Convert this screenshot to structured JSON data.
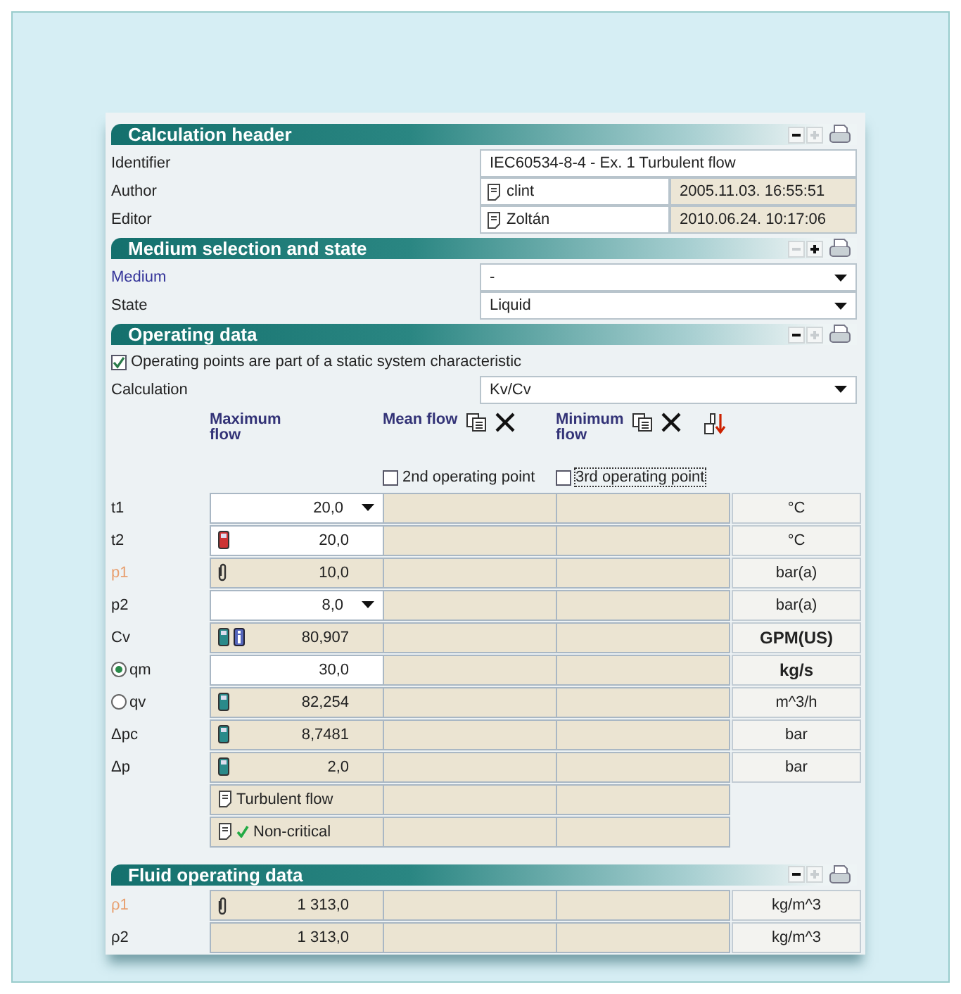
{
  "sections": [
    {
      "title": "Calculation header",
      "minus_enabled": true,
      "plus_enabled": false
    },
    {
      "title": "Medium selection and state",
      "minus_enabled": false,
      "plus_enabled": true
    },
    {
      "title": "Operating data",
      "minus_enabled": true,
      "plus_enabled": false
    },
    {
      "title": "Fluid operating data",
      "minus_enabled": true,
      "plus_enabled": false
    }
  ],
  "calculation_header": {
    "identifier": {
      "label": "Identifier",
      "value": "IEC60534-8-4 - Ex. 1 Turbulent flow"
    },
    "author": {
      "label": "Author",
      "value": "clint",
      "date": "2005.11.03. 16:55:51"
    },
    "editor": {
      "label": "Editor",
      "value": "Zoltán",
      "date": "2010.06.24. 10:17:06"
    }
  },
  "medium_selection": [
    {
      "label": "Medium",
      "value": "-",
      "color": "#333399"
    },
    {
      "label": "State",
      "value": "Liquid",
      "color": "#222222"
    }
  ],
  "operating_data": {
    "static_characteristic": {
      "label": "Operating points are part of a static system characteristic",
      "checked": true
    },
    "calculation": {
      "label": "Calculation",
      "value": "Kv/Cv"
    },
    "columns": [
      "Maximum flow",
      "Mean flow",
      "Minimum flow"
    ],
    "point_toggles": [
      {
        "label": "2nd operating point",
        "checked": false,
        "focused": false
      },
      {
        "label": "3rd operating point",
        "checked": false,
        "focused": true
      }
    ],
    "rows": [
      {
        "kind": "quantity",
        "label": "t1",
        "color": "#222222",
        "value": "20,0",
        "editable": true,
        "dropdown": true,
        "unit": "°C",
        "unit_bold": false
      },
      {
        "kind": "quantity",
        "label": "t2",
        "color": "#222222",
        "value": "20,0",
        "editable": true,
        "dropdown": false,
        "measured": true,
        "unit": "°C",
        "unit_bold": false
      },
      {
        "kind": "quantity",
        "label": "p1",
        "color": "#e8a070",
        "value": "10,0",
        "editable": false,
        "dropdown": false,
        "attached": true,
        "unit": "bar(a)",
        "unit_bold": false
      },
      {
        "kind": "quantity",
        "label": "p2",
        "color": "#222222",
        "value": "8,0",
        "editable": true,
        "dropdown": true,
        "unit": "bar(a)",
        "unit_bold": false
      },
      {
        "kind": "quantity",
        "label": "Cv",
        "color": "#222222",
        "value": "80,907",
        "editable": false,
        "dropdown": false,
        "computed": true,
        "info": true,
        "unit": "GPM(US)",
        "unit_bold": true
      },
      {
        "kind": "radio",
        "label": "qm",
        "selected": true,
        "color": "#222222",
        "value": "30,0",
        "editable": true,
        "dropdown": false,
        "unit": "kg/s",
        "unit_bold": true
      },
      {
        "kind": "radio",
        "label": "qv",
        "selected": false,
        "color": "#222222",
        "value": "82,254",
        "editable": false,
        "dropdown": false,
        "computed": true,
        "unit": "m^3/h",
        "unit_bold": false
      },
      {
        "kind": "quantity",
        "label": "Δpc",
        "color": "#222222",
        "value": "8,7481",
        "editable": false,
        "dropdown": false,
        "computed": true,
        "unit": "bar",
        "unit_bold": false
      },
      {
        "kind": "quantity",
        "label": "Δp",
        "color": "#222222",
        "value": "2,0",
        "editable": false,
        "dropdown": false,
        "computed": true,
        "unit": "bar",
        "unit_bold": false
      },
      {
        "kind": "note",
        "text": "Turbulent flow",
        "ok": false
      },
      {
        "kind": "note",
        "text": "Non-critical",
        "ok": true
      }
    ]
  },
  "fluid_operating_data": {
    "rows": [
      {
        "kind": "quantity",
        "label": "ρ1",
        "color": "#e8a070",
        "value": "1 313,0",
        "editable": false,
        "dropdown": false,
        "attached": true,
        "unit": "kg/m^3",
        "unit_bold": false
      },
      {
        "kind": "quantity",
        "label": "ρ2",
        "color": "#222222",
        "value": "1 313,0",
        "editable": false,
        "dropdown": false,
        "unit": "kg/m^3",
        "unit_bold": false
      }
    ]
  }
}
